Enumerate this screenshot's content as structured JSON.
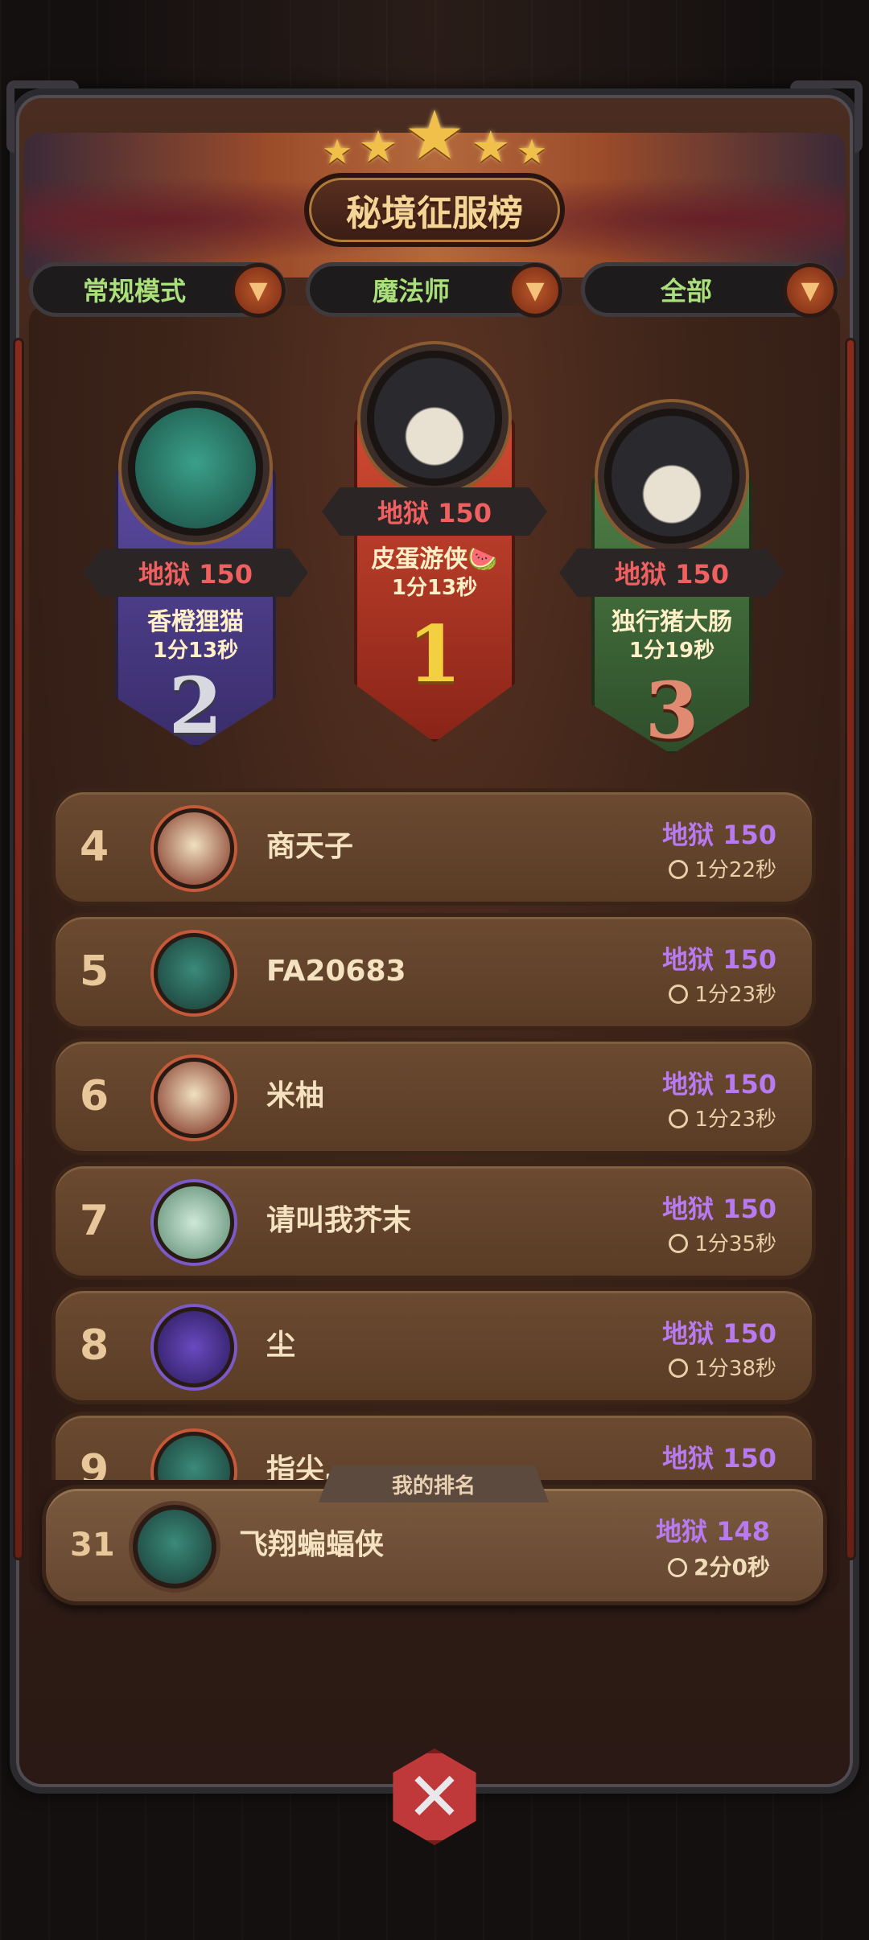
{
  "title": "秘境征服榜",
  "filters": [
    {
      "label": "常规模式"
    },
    {
      "label": "魔法师"
    },
    {
      "label": "全部"
    }
  ],
  "podium": {
    "first": {
      "rank": "1",
      "score": "地狱 150",
      "name": "皮蛋游侠🍉",
      "time": "1分13秒",
      "color": "#c0392b"
    },
    "second": {
      "rank": "2",
      "score": "地狱 150",
      "name": "香橙狸猫",
      "time": "1分13秒",
      "color": "#4a3d8a"
    },
    "third": {
      "rank": "3",
      "score": "地狱 150",
      "name": "独行猪大肠",
      "time": "1分19秒",
      "color": "#3e6a3a"
    }
  },
  "rows": [
    {
      "rank": "4",
      "name": "商天子",
      "score": "地狱 150",
      "time": "1分22秒"
    },
    {
      "rank": "5",
      "name": "FA20683",
      "score": "地狱 150",
      "time": "1分23秒"
    },
    {
      "rank": "6",
      "name": "米柚",
      "score": "地狱 150",
      "time": "1分23秒"
    },
    {
      "rank": "7",
      "name": "请叫我芥末",
      "score": "地狱 150",
      "time": "1分35秒"
    },
    {
      "rank": "8",
      "name": "尘",
      "score": "地狱 150",
      "time": "1分38秒"
    },
    {
      "rank": "9",
      "name": "指尖…",
      "score": "地狱 150",
      "time": ""
    }
  ],
  "my_rank": {
    "tab_label": "我的排名",
    "rank": "31",
    "name": "飞翔蝙蝠侠",
    "score": "地狱 148",
    "time": "2分0秒"
  }
}
